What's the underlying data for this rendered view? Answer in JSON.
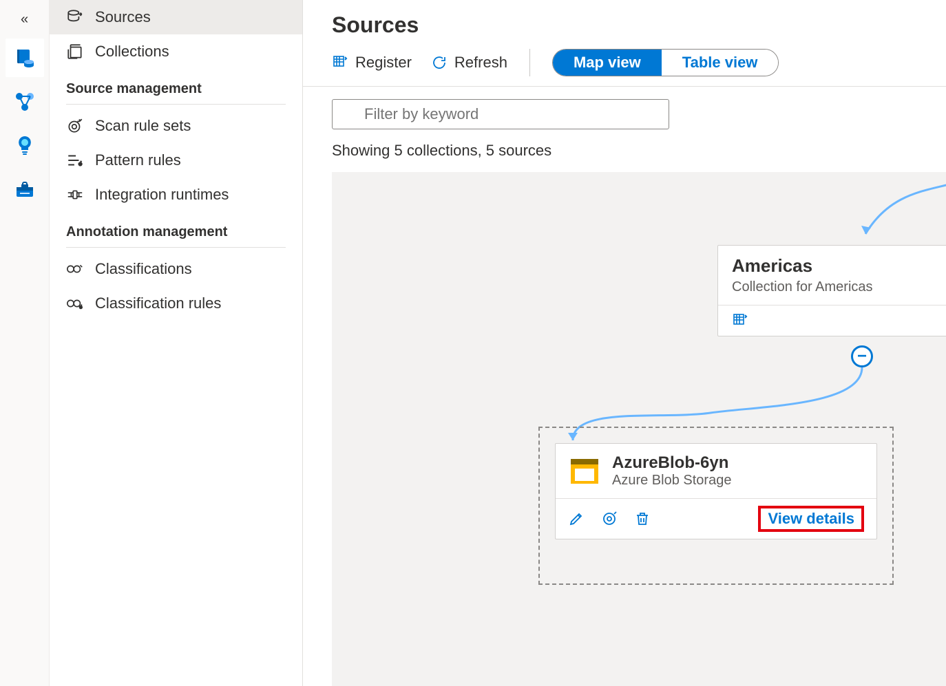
{
  "rail": {
    "items": [
      "catalog-icon",
      "datamap-icon",
      "insights-icon",
      "management-icon"
    ]
  },
  "nav": {
    "items": [
      {
        "label": "Sources"
      },
      {
        "label": "Collections"
      }
    ],
    "section1_title": "Source management",
    "section1_items": [
      {
        "label": "Scan rule sets"
      },
      {
        "label": "Pattern rules"
      },
      {
        "label": "Integration runtimes"
      }
    ],
    "section2_title": "Annotation management",
    "section2_items": [
      {
        "label": "Classifications"
      },
      {
        "label": "Classification rules"
      }
    ]
  },
  "page": {
    "title": "Sources"
  },
  "toolbar": {
    "register_label": "Register",
    "refresh_label": "Refresh",
    "map_view_label": "Map view",
    "table_view_label": "Table view"
  },
  "filter": {
    "placeholder": "Filter by keyword"
  },
  "status": {
    "line": "Showing 5 collections, 5 sources"
  },
  "collection": {
    "name": "Americas",
    "description": "Collection for Americas"
  },
  "source": {
    "name": "AzureBlob-6yn",
    "type": "Azure Blob Storage",
    "view_details_label": "View details"
  }
}
